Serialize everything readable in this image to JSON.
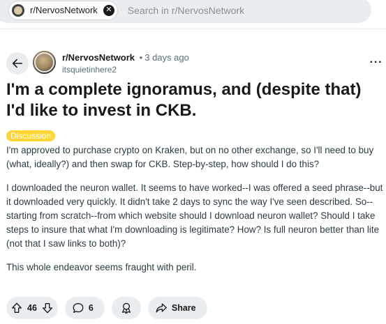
{
  "search": {
    "chip_label": "r/NervosNetwork",
    "placeholder": "Search in r/NervosNetwork"
  },
  "post": {
    "subreddit": "r/NervosNetwork",
    "separator": "•",
    "time": "3 days ago",
    "author": "itsquietinhere2",
    "overflow": "···",
    "title": "I'm a complete ignoramus, and (despite that) I'd like to invest in CKB.",
    "flair": "Discussion",
    "flair_color": "#ffd635",
    "paragraphs": [
      "I'm approved to purchase crypto on Kraken, but on no other exchange, so I'll need to buy (what, ideally?) and then swap for CKB. Step-by-step, how should I do this?",
      "I downloaded the neuron wallet. It seems to have worked--I was offered a seed phrase--but it downloaded very quickly. It didn't take 2 days to sync the way I've seen described. So--starting from scratch--from which website should I download neuron wallet? Should I take steps to insure that what I'm downloading is legitimate? How? Is full neuron better than lite (not that I saw links to both)?",
      "This whole endeavor seems fraught with peril."
    ]
  },
  "actions": {
    "upvote_icon": "upvote-icon",
    "vote_count": "46",
    "downvote_icon": "downvote-icon",
    "comment_icon": "comment-icon",
    "comment_count": "6",
    "award_icon": "award-icon",
    "share_icon": "share-icon",
    "share_label": "Share"
  },
  "colors": {
    "search_bg": "#eaedef",
    "pill_bg": "#eaedef",
    "meta_text": "#576f76"
  }
}
